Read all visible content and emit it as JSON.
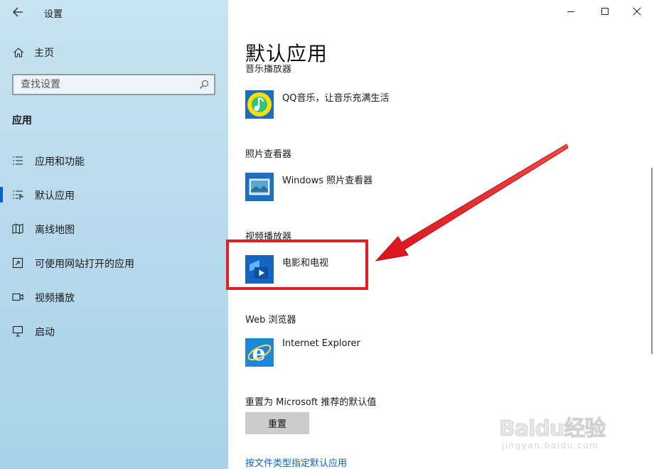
{
  "window": {
    "title": "设置"
  },
  "sidebar": {
    "home_label": "主页",
    "search": {
      "placeholder": "查找设置"
    },
    "section_title": "应用",
    "items": [
      {
        "label": "应用和功能",
        "icon": "apps-features-icon",
        "selected": false
      },
      {
        "label": "默认应用",
        "icon": "default-apps-icon",
        "selected": true
      },
      {
        "label": "离线地图",
        "icon": "offline-maps-icon",
        "selected": false
      },
      {
        "label": "可使用网站打开的应用",
        "icon": "apps-for-websites-icon",
        "selected": false
      },
      {
        "label": "视频播放",
        "icon": "video-playback-icon",
        "selected": false
      },
      {
        "label": "启动",
        "icon": "startup-icon",
        "selected": false
      }
    ]
  },
  "main": {
    "title": "默认应用",
    "cut_off_label": "音乐播放器",
    "sections": [
      {
        "label": "",
        "app_name": "QQ音乐，让音乐充满生活",
        "icon": "qq-music-icon"
      },
      {
        "label": "照片查看器",
        "app_name": "Windows 照片查看器",
        "icon": "photo-viewer-icon"
      },
      {
        "label": "视频播放器",
        "app_name": "电影和电视",
        "icon": "movies-tv-icon"
      },
      {
        "label": "Web 浏览器",
        "app_name": "Internet Explorer",
        "icon": "internet-explorer-icon"
      }
    ],
    "reset_label": "重置为 Microsoft 推荐的默认值",
    "reset_button": "重置",
    "link_text": "按文件类型指定默认应用"
  },
  "annotation": {
    "highlight_color": "#e12020",
    "arrow_color": "#e12020"
  },
  "watermark": {
    "main": "Baidu经验",
    "sub": "jingyan.baidu.com"
  },
  "colors": {
    "sidebar_bg": "#b6d9ec",
    "accent": "#0a64c8",
    "button_bg": "#cccccc"
  }
}
